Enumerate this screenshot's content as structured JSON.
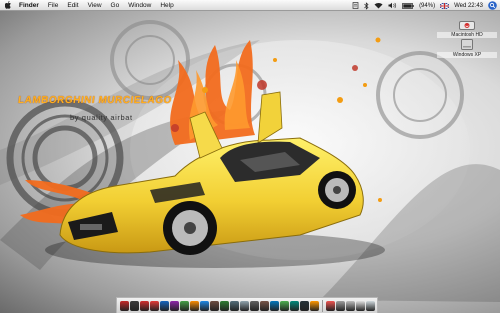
{
  "menubar": {
    "items": [
      "Finder",
      "File",
      "Edit",
      "View",
      "Go",
      "Window",
      "Help"
    ],
    "battery": "(94%)",
    "clock": "Wed 22:43"
  },
  "desktop": {
    "icons": [
      {
        "label": "Macintosh HD",
        "icon": "hard-drive-icon"
      },
      {
        "label": "Windows XP",
        "icon": "hard-drive-icon"
      }
    ],
    "wallpaper": {
      "title": "LAMBORGHINI MURCIELAGO",
      "subtitle": "by quality airbat"
    }
  },
  "dock": {
    "colors": [
      "#c62828",
      "#3a3a3a",
      "#d32f2f",
      "#e53935",
      "#1565c0",
      "#8e24aa",
      "#43a047",
      "#fb8c00",
      "#1e88e5",
      "#6d4c41",
      "#2e7d32",
      "#546e7a",
      "#90a4ae",
      "#616161",
      "#795548",
      "#0277bd",
      "#4caf50",
      "#00897b",
      "#263238",
      "#ff9800",
      "#ef5350",
      "#9e9e9e",
      "#bdbdbd",
      "#e0e0e0",
      "#cfd8dc"
    ]
  },
  "palette": {
    "car": "#f3d23a",
    "flames": "#f26b1d",
    "accent": "#c0392b"
  }
}
